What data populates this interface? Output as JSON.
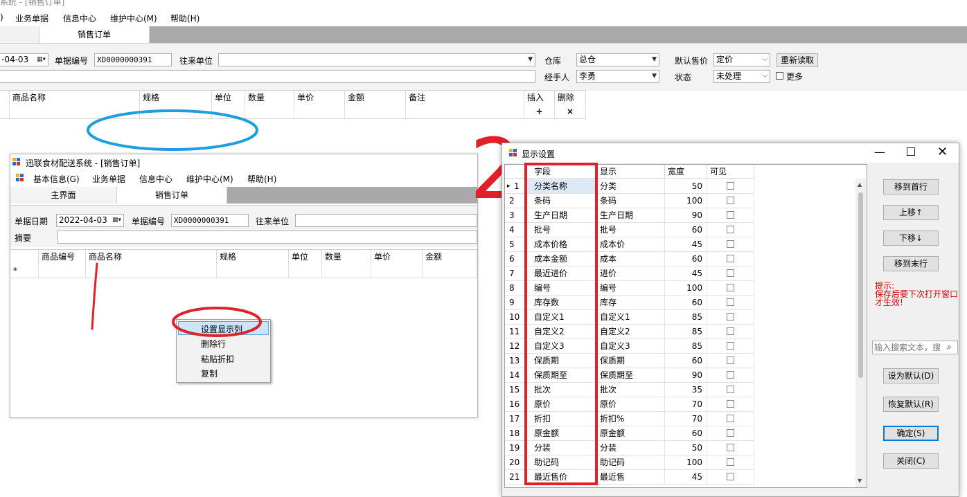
{
  "bg_app": {
    "title": "系统 - [销售订单]",
    "menu": [
      ")",
      "业务单据",
      "信息中心",
      "维护中心(M)",
      "帮助(H)"
    ],
    "tabs": [
      "销售订单"
    ],
    "form": {
      "date_value": "-04-03",
      "doc_no_label": "单据编号",
      "doc_no_value": "XD0000000391",
      "partner_label": "往来单位",
      "warehouse_label": "仓库",
      "warehouse_value": "总仓",
      "price_label": "默认售价",
      "price_value": "定价",
      "reload_button": "重新读取",
      "handler_label": "经手人",
      "handler_value": "李勇",
      "status_label": "状态",
      "status_value": "未处理",
      "more_label": "更多"
    },
    "grid_headers": [
      "商品名称",
      "规格",
      "单位",
      "数量",
      "单价",
      "金额",
      "备注",
      "插入",
      "删除"
    ],
    "insert_symbol": "+",
    "delete_symbol": "×"
  },
  "inner_window": {
    "title": "迅联食材配送系统 - [销售订单]",
    "menu": [
      "基本信息(G)",
      "业务单据",
      "信息中心",
      "维护中心(M)",
      "帮助(H)"
    ],
    "tabs": [
      "主界面",
      "销售订单"
    ],
    "date_label": "单据日期",
    "date_value": "2022-04-03",
    "doc_no_label": "单据编号",
    "doc_no_value": "XD0000000391",
    "partner_label": "往来单位",
    "memo_label": "摘要",
    "grid_headers": [
      "商品编号",
      "商品名称",
      "规格",
      "单位",
      "数量",
      "单价",
      "金额"
    ],
    "new_row_marker": "*",
    "context_menu": [
      "设置显示列",
      "删除行",
      "粘贴折扣",
      "复制"
    ]
  },
  "dialog": {
    "title": "显示设置",
    "headers": [
      "字段",
      "显示",
      "宽度",
      "可见"
    ],
    "rows": [
      {
        "n": "1",
        "field": "分类名称",
        "display": "分类",
        "width": "50"
      },
      {
        "n": "2",
        "field": "条码",
        "display": "条码",
        "width": "100"
      },
      {
        "n": "3",
        "field": "生产日期",
        "display": "生产日期",
        "width": "90"
      },
      {
        "n": "4",
        "field": "批号",
        "display": "批号",
        "width": "60"
      },
      {
        "n": "5",
        "field": "成本价格",
        "display": "成本价",
        "width": "45"
      },
      {
        "n": "6",
        "field": "成本金额",
        "display": "成本",
        "width": "60"
      },
      {
        "n": "7",
        "field": "最近进价",
        "display": "进价",
        "width": "45"
      },
      {
        "n": "8",
        "field": "编号",
        "display": "编号",
        "width": "100"
      },
      {
        "n": "9",
        "field": "库存数",
        "display": "库存",
        "width": "60"
      },
      {
        "n": "10",
        "field": "自定义1",
        "display": "自定义1",
        "width": "85"
      },
      {
        "n": "11",
        "field": "自定义2",
        "display": "自定义2",
        "width": "85"
      },
      {
        "n": "12",
        "field": "自定义3",
        "display": "自定义3",
        "width": "85"
      },
      {
        "n": "13",
        "field": "保质期",
        "display": "保质期",
        "width": "60"
      },
      {
        "n": "14",
        "field": "保质期至",
        "display": "保质期至",
        "width": "90"
      },
      {
        "n": "15",
        "field": "批次",
        "display": "批次",
        "width": "35"
      },
      {
        "n": "16",
        "field": "原价",
        "display": "原价",
        "width": "70"
      },
      {
        "n": "17",
        "field": "折扣",
        "display": "折扣%",
        "width": "70"
      },
      {
        "n": "18",
        "field": "原金额",
        "display": "原金额",
        "width": "60"
      },
      {
        "n": "19",
        "field": "分装",
        "display": "分装",
        "width": "50"
      },
      {
        "n": "20",
        "field": "助记码",
        "display": "助记码",
        "width": "100"
      },
      {
        "n": "21",
        "field": "最近售价",
        "display": "最近售",
        "width": "45"
      }
    ],
    "buttons": {
      "move_first": "移到首行",
      "move_up": "上移↑",
      "move_down": "下移↓",
      "move_last": "移到末行",
      "set_default": "设为默认(D)",
      "restore_default": "恢复默认(R)",
      "ok": "确定(S)",
      "close": "关闭(C)"
    },
    "hint_title": "提示:",
    "hint_text": "保存后要下次打开窗口才生效!",
    "search_placeholder": "输入搜索文本，搜",
    "selected_row_marker": "▸"
  },
  "annotation_text": "2",
  "colors": {
    "annotation_red": "#e2202a",
    "annotation_blue": "#1e9ee0",
    "hint_red": "#d40000"
  }
}
